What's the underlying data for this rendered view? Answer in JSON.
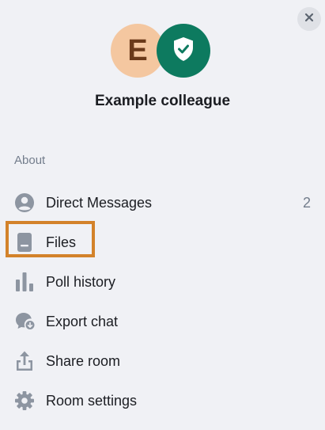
{
  "header": {
    "close_icon": "close-icon",
    "avatar_initial": "E",
    "verified_icon": "shield-check-icon",
    "room_name": "Example colleague"
  },
  "section": {
    "label": "About"
  },
  "menu": {
    "items": [
      {
        "label": "Direct Messages",
        "icon": "user-circle-icon",
        "count": "2"
      },
      {
        "label": "Files",
        "icon": "file-icon",
        "focused": true
      },
      {
        "label": "Poll history",
        "icon": "poll-icon"
      },
      {
        "label": "Export chat",
        "icon": "export-chat-icon"
      },
      {
        "label": "Share room",
        "icon": "share-icon"
      },
      {
        "label": "Room settings",
        "icon": "gear-icon"
      }
    ]
  },
  "colors": {
    "background": "#f0f1f5",
    "avatar_bg": "#f4c7a0",
    "avatar_text": "#6b3a1a",
    "verified_bg": "#0d7a5f",
    "focus_ring": "#d3822a",
    "icon": "#8d95a1",
    "muted_text": "#737d8c"
  }
}
